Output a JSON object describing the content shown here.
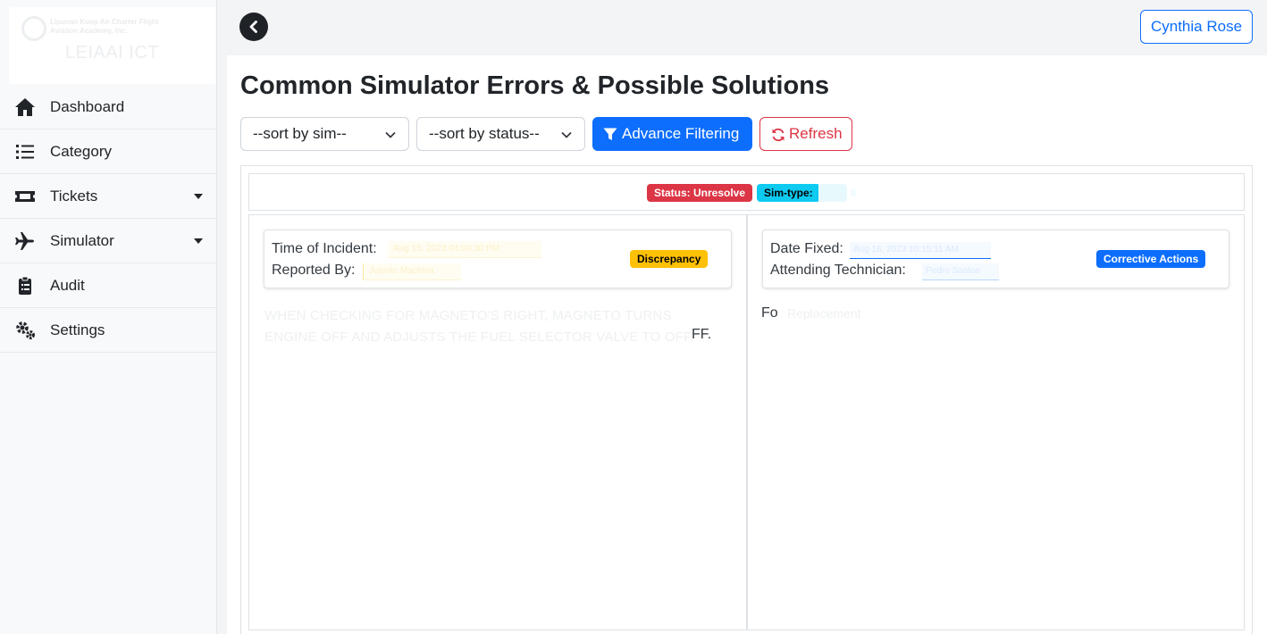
{
  "sidebar": {
    "logo": {
      "line1": "Lipunan Koop Air Charter Flight",
      "line2": "Aviation Academy, Inc.",
      "text": "LEIAAI ICT"
    },
    "items": [
      {
        "label": "Dashboard",
        "icon": "home-icon"
      },
      {
        "label": "Category",
        "icon": "list-icon"
      },
      {
        "label": "Tickets",
        "icon": "ticket-icon",
        "has_caret": true
      },
      {
        "label": "Simulator",
        "icon": "plane-icon",
        "has_caret": true
      },
      {
        "label": "Audit",
        "icon": "clipboard-icon"
      },
      {
        "label": "Settings",
        "icon": "gears-icon"
      }
    ]
  },
  "header": {
    "user_name": "Cynthia Rose"
  },
  "page": {
    "title": "Common Simulator Errors & Possible Solutions"
  },
  "toolbar": {
    "sort_by_sim": "--sort by sim--",
    "sort_by_status": "--sort by status--",
    "advance_filtering": "Advance Filtering",
    "refresh": "Refresh"
  },
  "filters": {
    "status_badge": "Status: Unresolve",
    "sim_type_badge": "Sim-type:"
  },
  "discrepancy": {
    "time_label": "Time of Incident:",
    "time_value": "Aug 15, 2023 04:00:30 PM",
    "reported_label": "Reported By:",
    "reported_value": "Juanito Machina",
    "badge": "Discrepancy",
    "description": "WHEN CHECKING FOR MAGNETO'S RIGHT, MAGNETO TURNS ENGINE OFF AND ADJUSTS THE FUEL SELECTOR VALVE TO OFF.",
    "description_tail": "FF."
  },
  "corrective": {
    "date_label": "Date Fixed:",
    "date_value": "Aug 16, 2023 10:15:11 AM",
    "tech_label": "Attending Technician:",
    "tech_value": "Pedro Santos",
    "badge": "Corrective Actions",
    "action_prefix": "Fo",
    "action_text": "Replacement"
  },
  "colors": {
    "primary": "#0d6efd",
    "danger": "#dc3545",
    "info": "#0dcaf0",
    "warning": "#ffc107"
  }
}
